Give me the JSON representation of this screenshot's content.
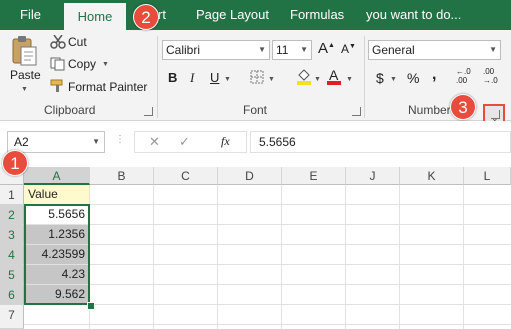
{
  "tabs": [
    "File",
    "Home",
    "Insert",
    "Page Layout",
    "Formulas",
    "you want to do..."
  ],
  "tabs_visible": {
    "file": "File",
    "home": "Home",
    "insert_fragment": "rt",
    "page_layout": "Page Layout",
    "formulas": "Formulas",
    "tell_me": "you want to do..."
  },
  "clipboard": {
    "paste": "Paste",
    "cut": "Cut",
    "copy": "Copy",
    "format_painter": "Format Painter",
    "group": "Clipboard"
  },
  "font": {
    "name": "Calibri",
    "size": "11",
    "bold": "B",
    "italic": "I",
    "underline": "U",
    "font_color": "A",
    "grow": "A",
    "shrink": "A",
    "group": "Font"
  },
  "number": {
    "format": "General",
    "currency": "$",
    "percent": "%",
    "comma": ",",
    "increase_decimal": "←.0 .00",
    "decrease_decimal": ".00 →.0",
    "group": "Number"
  },
  "badges": [
    "1",
    "2",
    "3"
  ],
  "formula_bar": {
    "name_box": "A2",
    "cancel": "✕",
    "enter": "✓",
    "fx": "fx",
    "value": "5.5656"
  },
  "columns": [
    "A",
    "B",
    "C",
    "D",
    "E",
    "J",
    "K",
    "L"
  ],
  "rows": [
    "1",
    "2",
    "3",
    "4",
    "5",
    "6",
    "7"
  ],
  "cells": {
    "header": "Value",
    "values": [
      "5.5656",
      "1.2356",
      "4.23599",
      "4.23",
      "9.562"
    ]
  },
  "colors": {
    "accent": "#217346",
    "selection": "#c6c6c6",
    "header_fill": "#fffacd",
    "badge": "#e74c3c"
  }
}
